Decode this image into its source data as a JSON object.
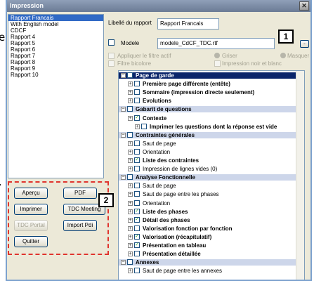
{
  "dialog": {
    "title": "Impression"
  },
  "background": {
    "frag1": "e",
    "frag2": "."
  },
  "models": [
    "Rapport Francais",
    "With English model",
    "CDCF",
    "Rapport 4",
    "Rapport 5",
    "Rapport 6",
    "Rapport 7",
    "Rapport 8",
    "Rapport 9",
    "Rapport 10"
  ],
  "buttons": {
    "apercu": "Aperçu",
    "pdf": "PDF",
    "imprimer": "Imprimer",
    "tdc_meeting": "TDC Meeting",
    "tdc_portal": "TDC Portal",
    "import_pdi": "Import Pdi",
    "quitter": "Quitter"
  },
  "callouts": {
    "one": "1",
    "two": "2"
  },
  "form": {
    "libelle_label": "Libellé du rapport",
    "libelle_value": "Rapport Francais",
    "modele_label": "Modele",
    "modele_value": "modele_CdCF_TDC.rtf",
    "browse": "...",
    "appliquer": "Appliquer le filtre actif",
    "griser": "Griser",
    "masquer": "Masquer",
    "filtre_bicolore": "Filtre bicolore",
    "impression_nb": "Impression noir et blanc"
  },
  "tree": [
    {
      "text": "Page de garde",
      "kind": "section-selected",
      "indent": 0
    },
    {
      "text": "Première page différente (entête)",
      "kind": "item-bold",
      "indent": 1
    },
    {
      "text": "Sommaire  (impression directe seulement)",
      "kind": "item-bold",
      "indent": 1
    },
    {
      "text": "Evolutions",
      "kind": "item-bold",
      "indent": 1
    },
    {
      "text": "Gabarit de questions",
      "kind": "section",
      "indent": 0
    },
    {
      "text": "Contexte",
      "kind": "item-bold-checked",
      "indent": 1
    },
    {
      "text": "Imprimer les questions dont la réponse est vide",
      "kind": "item-bold",
      "indent": 2
    },
    {
      "text": "Contraintes générales",
      "kind": "section",
      "indent": 0
    },
    {
      "text": "Saut de page",
      "kind": "item",
      "indent": 1
    },
    {
      "text": "Orientation",
      "kind": "item",
      "indent": 1
    },
    {
      "text": "Liste des contraintes",
      "kind": "item-bold-checked",
      "indent": 1
    },
    {
      "text": "Impression de lignes vides (0)",
      "kind": "item",
      "indent": 1
    },
    {
      "text": "Analyse Fonctionnelle",
      "kind": "section",
      "indent": 0
    },
    {
      "text": "Saut de page",
      "kind": "item",
      "indent": 1
    },
    {
      "text": "Saut de page entre les phases",
      "kind": "item",
      "indent": 1
    },
    {
      "text": "Orientation",
      "kind": "item",
      "indent": 1
    },
    {
      "text": "Liste des phases",
      "kind": "item-bold-checked",
      "indent": 1
    },
    {
      "text": "Détail des phases",
      "kind": "item-bold-checked",
      "indent": 1
    },
    {
      "text": "Valorisation fonction par fonction",
      "kind": "item-bold",
      "indent": 1
    },
    {
      "text": "Valorisation (récapitulatif)",
      "kind": "item-bold-checked",
      "indent": 1
    },
    {
      "text": "Présentation en tableau",
      "kind": "item-bold-checked",
      "indent": 1
    },
    {
      "text": "Présentation détaillée",
      "kind": "item-bold",
      "indent": 1
    },
    {
      "text": "Annexes",
      "kind": "section",
      "indent": 0
    },
    {
      "text": "Saut de page entre les annexes",
      "kind": "item",
      "indent": 1
    }
  ]
}
